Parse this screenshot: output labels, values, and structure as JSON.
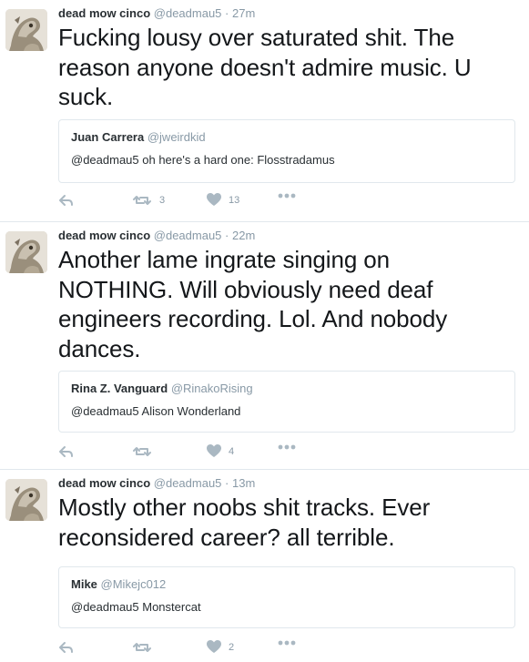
{
  "icons": {
    "reply": "reply-icon",
    "retweet": "retweet-icon",
    "like": "heart-icon",
    "more": "more-icon"
  },
  "colors": {
    "meta": "#8899a6",
    "action_icon": "#aab8c2",
    "divider": "#e1e8ed"
  },
  "tweets": [
    {
      "name": "dead mow cinco",
      "handle": "@deadmau5",
      "separator": "·",
      "time": "27m",
      "text": "Fucking lousy over saturated shit. The reason anyone doesn't admire music. U suck.",
      "quote": {
        "name": "Juan Carrera",
        "handle": "@jweirdkid",
        "text": "@deadmau5 oh here's a hard one: Flosstradamus"
      },
      "retweets": "3",
      "likes": "13"
    },
    {
      "name": "dead mow cinco",
      "handle": "@deadmau5",
      "separator": "·",
      "time": "22m",
      "text": "Another lame ingrate singing on NOTHING. Will obviously need deaf engineers recording. Lol. And nobody dances.",
      "quote": {
        "name": "Rina Z. Vanguard",
        "handle": "@RinakoRising",
        "text": "@deadmau5 Alison Wonderland"
      },
      "retweets": "",
      "likes": "4"
    },
    {
      "name": "dead mow cinco",
      "handle": "@deadmau5",
      "separator": "·",
      "time": "13m",
      "text": "Mostly other noobs shit tracks. Ever reconsidered career? all terrible.",
      "quote": {
        "name": "Mike",
        "handle": "@Mikejc012",
        "text": "@deadmau5 Monstercat"
      },
      "retweets": "",
      "likes": "2"
    }
  ]
}
